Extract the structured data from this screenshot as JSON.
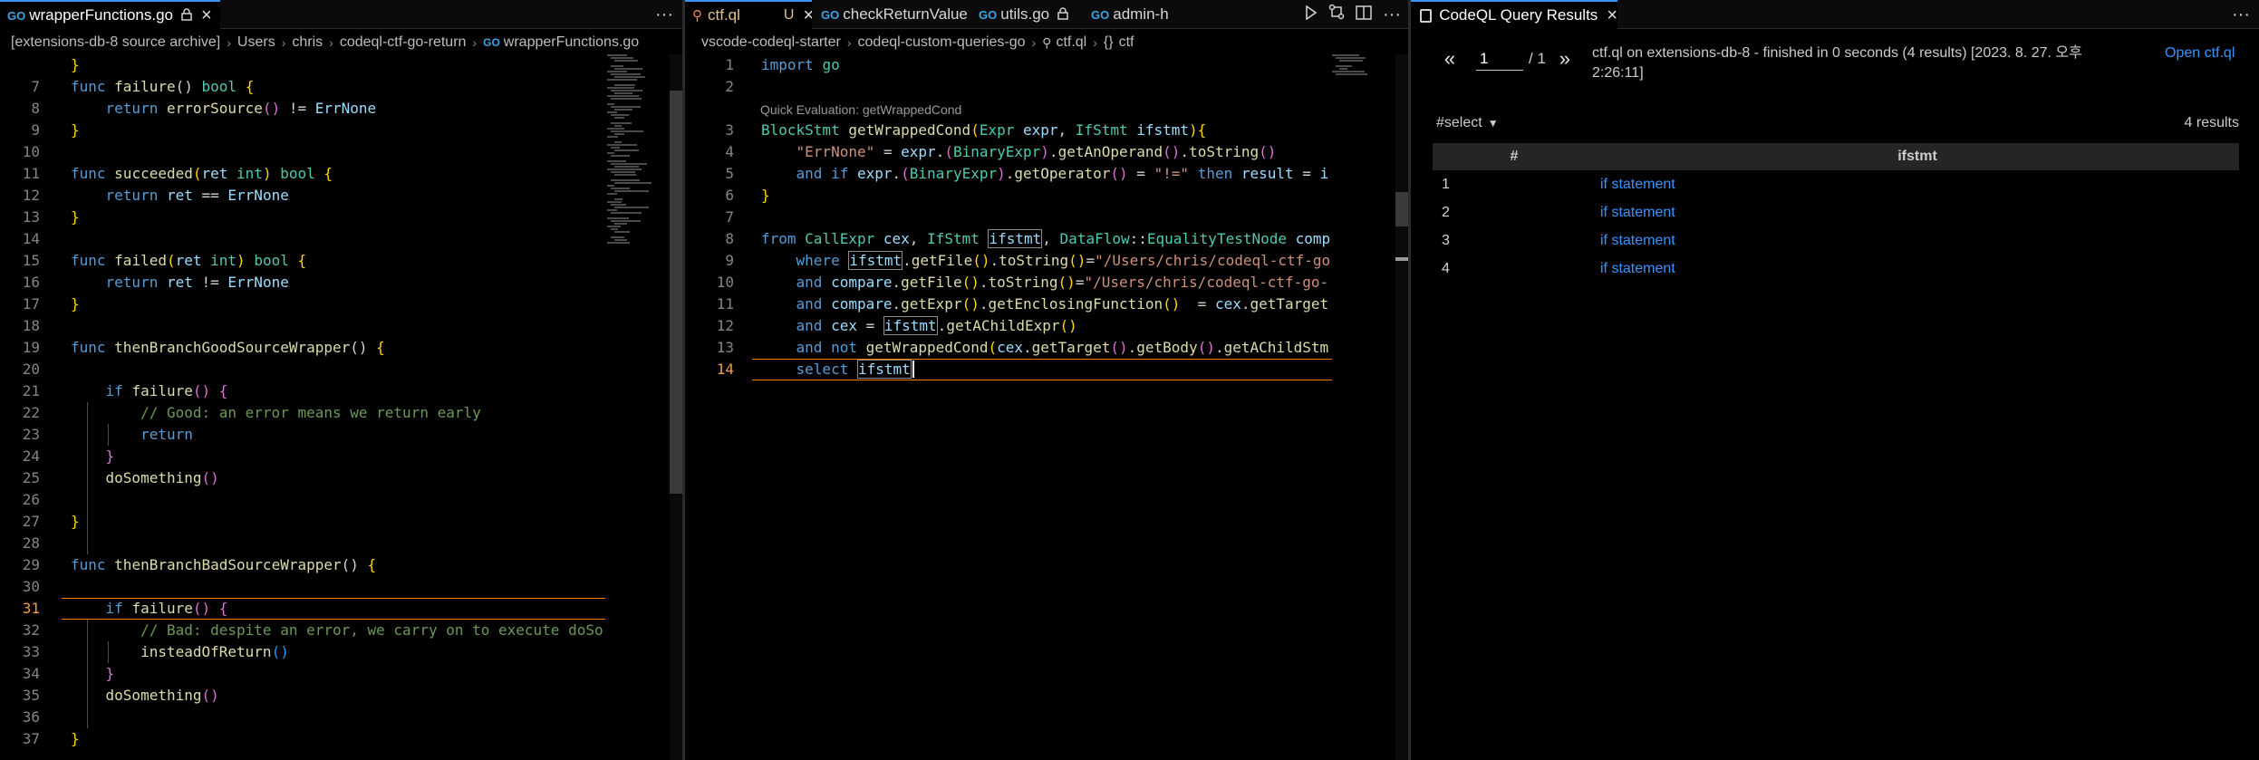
{
  "left_editor": {
    "tab": {
      "label": "wrapperFunctions.go"
    },
    "breadcrumb": [
      "[extensions-db-8 source archive]",
      "Users",
      "chris",
      "codeql-ctf-go-return",
      "wrapperFunctions.go"
    ],
    "current_line": "31",
    "lines": [
      {
        "n": "",
        "code": [
          {
            "t": "}",
            "c": "p1"
          }
        ]
      },
      {
        "n": "7",
        "code": [
          {
            "t": "func ",
            "c": "k"
          },
          {
            "t": "failure",
            "c": "f"
          },
          {
            "t": "() "
          },
          {
            "t": "bool ",
            "c": "t"
          },
          {
            "t": "{",
            "c": "p1"
          }
        ]
      },
      {
        "n": "8",
        "code": [
          {
            "t": "    return ",
            "c": "k"
          },
          {
            "t": "errorSource",
            "c": "f"
          },
          {
            "t": "()",
            "c": "p2"
          },
          {
            "t": " != "
          },
          {
            "t": "ErrNone",
            "c": "v"
          }
        ]
      },
      {
        "n": "9",
        "code": [
          {
            "t": "}",
            "c": "p1"
          }
        ]
      },
      {
        "n": "10",
        "code": []
      },
      {
        "n": "11",
        "code": [
          {
            "t": "func ",
            "c": "k"
          },
          {
            "t": "succeeded",
            "c": "f"
          },
          {
            "t": "(",
            "c": "p1"
          },
          {
            "t": "ret ",
            "c": "v"
          },
          {
            "t": "int",
            "c": "t"
          },
          {
            "t": ") ",
            "c": "p1"
          },
          {
            "t": "bool ",
            "c": "t"
          },
          {
            "t": "{",
            "c": "p1"
          }
        ]
      },
      {
        "n": "12",
        "code": [
          {
            "t": "    return ",
            "c": "k"
          },
          {
            "t": "ret ",
            "c": "v"
          },
          {
            "t": "== "
          },
          {
            "t": "ErrNone",
            "c": "v"
          }
        ]
      },
      {
        "n": "13",
        "code": [
          {
            "t": "}",
            "c": "p1"
          }
        ]
      },
      {
        "n": "14",
        "code": []
      },
      {
        "n": "15",
        "code": [
          {
            "t": "func ",
            "c": "k"
          },
          {
            "t": "failed",
            "c": "f"
          },
          {
            "t": "(",
            "c": "p1"
          },
          {
            "t": "ret ",
            "c": "v"
          },
          {
            "t": "int",
            "c": "t"
          },
          {
            "t": ") ",
            "c": "p1"
          },
          {
            "t": "bool ",
            "c": "t"
          },
          {
            "t": "{",
            "c": "p1"
          }
        ]
      },
      {
        "n": "16",
        "code": [
          {
            "t": "    return ",
            "c": "k"
          },
          {
            "t": "ret ",
            "c": "v"
          },
          {
            "t": "!= "
          },
          {
            "t": "ErrNone",
            "c": "v"
          }
        ]
      },
      {
        "n": "17",
        "code": [
          {
            "t": "}",
            "c": "p1"
          }
        ]
      },
      {
        "n": "18",
        "code": []
      },
      {
        "n": "19",
        "code": [
          {
            "t": "func ",
            "c": "k"
          },
          {
            "t": "thenBranchGoodSourceWrapper",
            "c": "f"
          },
          {
            "t": "() "
          },
          {
            "t": "{",
            "c": "p1"
          }
        ]
      },
      {
        "n": "20",
        "code": []
      },
      {
        "n": "21",
        "code": [
          {
            "t": "    if ",
            "c": "k"
          },
          {
            "t": "failure",
            "c": "f"
          },
          {
            "t": "() ",
            "c": "p2"
          },
          {
            "t": "{",
            "c": "p2"
          }
        ]
      },
      {
        "n": "22",
        "code": [
          {
            "t": "        // Good: an error means we return early",
            "c": "c"
          }
        ]
      },
      {
        "n": "23",
        "code": [
          {
            "t": "        return",
            "c": "k"
          }
        ]
      },
      {
        "n": "24",
        "code": [
          {
            "t": "    }",
            "c": "p2"
          }
        ]
      },
      {
        "n": "25",
        "code": [
          {
            "t": "    doSomething",
            "c": "f"
          },
          {
            "t": "()",
            "c": "p2"
          }
        ]
      },
      {
        "n": "26",
        "code": []
      },
      {
        "n": "27",
        "code": [
          {
            "t": "}",
            "c": "p1"
          }
        ]
      },
      {
        "n": "28",
        "code": []
      },
      {
        "n": "29",
        "code": [
          {
            "t": "func ",
            "c": "k"
          },
          {
            "t": "thenBranchBadSourceWrapper",
            "c": "f"
          },
          {
            "t": "() "
          },
          {
            "t": "{",
            "c": "p1"
          }
        ]
      },
      {
        "n": "30",
        "code": []
      },
      {
        "n": "31",
        "code": [
          {
            "t": "    if ",
            "c": "k"
          },
          {
            "t": "failure",
            "c": "f"
          },
          {
            "t": "() ",
            "c": "p2"
          },
          {
            "t": "{",
            "c": "p2"
          }
        ]
      },
      {
        "n": "32",
        "code": [
          {
            "t": "        // Bad: despite an error, we carry on to execute doSo",
            "c": "c"
          }
        ]
      },
      {
        "n": "33",
        "code": [
          {
            "t": "        insteadOfReturn",
            "c": "f"
          },
          {
            "t": "()",
            "c": "p3"
          }
        ]
      },
      {
        "n": "34",
        "code": [
          {
            "t": "    }",
            "c": "p2"
          }
        ]
      },
      {
        "n": "35",
        "code": [
          {
            "t": "    doSomething",
            "c": "f"
          },
          {
            "t": "()",
            "c": "p2"
          }
        ]
      },
      {
        "n": "36",
        "code": []
      },
      {
        "n": "37",
        "code": [
          {
            "t": "}",
            "c": "p1"
          }
        ]
      }
    ]
  },
  "middle_editor": {
    "tabs": [
      {
        "label": "ctf.ql",
        "status": "U"
      },
      {
        "label": "checkReturnValue.go"
      },
      {
        "label": "utils.go"
      },
      {
        "label": "admin-h"
      }
    ],
    "breadcrumb": [
      "vscode-codeql-starter",
      "codeql-custom-queries-go",
      "ctf.ql",
      "ctf"
    ],
    "breadcrumb_symbol": "{}",
    "codelens": "Quick Evaluation: getWrappedCond",
    "current_line": "14",
    "lines": [
      {
        "n": "1",
        "code": [
          {
            "t": "import ",
            "c": "k"
          },
          {
            "t": "go",
            "c": "t"
          }
        ]
      },
      {
        "n": "2",
        "code": []
      },
      {
        "n": "3",
        "code": [
          {
            "t": "BlockStmt ",
            "c": "t"
          },
          {
            "t": "getWrappedCond",
            "c": "f"
          },
          {
            "t": "(",
            "c": "p1"
          },
          {
            "t": "Expr ",
            "c": "t"
          },
          {
            "t": "expr",
            "c": "v"
          },
          {
            "t": ", "
          },
          {
            "t": "IfStmt ",
            "c": "t"
          },
          {
            "t": "ifstmt",
            "c": "v"
          },
          {
            "t": ")",
            "c": "p1"
          },
          {
            "t": "{",
            "c": "p1"
          }
        ]
      },
      {
        "n": "4",
        "code": [
          {
            "t": "    \"ErrNone\"",
            "c": "s"
          },
          {
            "t": " = "
          },
          {
            "t": "expr",
            "c": "v"
          },
          {
            "t": "."
          },
          {
            "t": "(",
            "c": "p2"
          },
          {
            "t": "BinaryExpr",
            "c": "t"
          },
          {
            "t": ")",
            "c": "p2"
          },
          {
            "t": "."
          },
          {
            "t": "getAnOperand",
            "c": "f"
          },
          {
            "t": "()",
            "c": "p2"
          },
          {
            "t": "."
          },
          {
            "t": "toString",
            "c": "f"
          },
          {
            "t": "()",
            "c": "p2"
          }
        ]
      },
      {
        "n": "5",
        "code": [
          {
            "t": "    and if ",
            "c": "k"
          },
          {
            "t": "expr",
            "c": "v"
          },
          {
            "t": "."
          },
          {
            "t": "(",
            "c": "p2"
          },
          {
            "t": "BinaryExpr",
            "c": "t"
          },
          {
            "t": ")",
            "c": "p2"
          },
          {
            "t": "."
          },
          {
            "t": "getOperator",
            "c": "f"
          },
          {
            "t": "()",
            "c": "p2"
          },
          {
            "t": " = "
          },
          {
            "t": "\"!=\"",
            "c": "s"
          },
          {
            "t": " then ",
            "c": "k"
          },
          {
            "t": "result",
            "c": "v"
          },
          {
            "t": " = "
          },
          {
            "t": "i",
            "c": "v"
          }
        ]
      },
      {
        "n": "6",
        "code": [
          {
            "t": "}",
            "c": "p1"
          }
        ]
      },
      {
        "n": "7",
        "code": []
      },
      {
        "n": "8",
        "code": [
          {
            "t": "from ",
            "c": "k"
          },
          {
            "t": "CallExpr ",
            "c": "t"
          },
          {
            "t": "cex",
            "c": "v"
          },
          {
            "t": ", "
          },
          {
            "t": "IfStmt ",
            "c": "t"
          },
          {
            "t": "ifstmt",
            "c": "v",
            "h": true
          },
          {
            "t": ", "
          },
          {
            "t": "DataFlow",
            "c": "t"
          },
          {
            "t": "::"
          },
          {
            "t": "EqualityTestNode ",
            "c": "t"
          },
          {
            "t": "comp",
            "c": "v"
          }
        ]
      },
      {
        "n": "9",
        "code": [
          {
            "t": "    where ",
            "c": "k"
          },
          {
            "t": "ifstmt",
            "c": "v",
            "h": true
          },
          {
            "t": "."
          },
          {
            "t": "getFile",
            "c": "f"
          },
          {
            "t": "()",
            "c": "p1"
          },
          {
            "t": "."
          },
          {
            "t": "toString",
            "c": "f"
          },
          {
            "t": "()",
            "c": "p1"
          },
          {
            "t": "="
          },
          {
            "t": "\"/Users/chris/codeql-ctf-go",
            "c": "s"
          }
        ]
      },
      {
        "n": "10",
        "code": [
          {
            "t": "    and ",
            "c": "k"
          },
          {
            "t": "compare",
            "c": "v"
          },
          {
            "t": "."
          },
          {
            "t": "getFile",
            "c": "f"
          },
          {
            "t": "()",
            "c": "p1"
          },
          {
            "t": "."
          },
          {
            "t": "toString",
            "c": "f"
          },
          {
            "t": "()",
            "c": "p1"
          },
          {
            "t": "="
          },
          {
            "t": "\"/Users/chris/codeql-ctf-go-",
            "c": "s"
          }
        ]
      },
      {
        "n": "11",
        "code": [
          {
            "t": "    and ",
            "c": "k"
          },
          {
            "t": "compare",
            "c": "v"
          },
          {
            "t": "."
          },
          {
            "t": "getExpr",
            "c": "f"
          },
          {
            "t": "()",
            "c": "p1"
          },
          {
            "t": "."
          },
          {
            "t": "getEnclosingFunction",
            "c": "f"
          },
          {
            "t": "()",
            "c": "p1"
          },
          {
            "t": "  = "
          },
          {
            "t": "cex",
            "c": "v"
          },
          {
            "t": "."
          },
          {
            "t": "getTarget",
            "c": "f"
          }
        ]
      },
      {
        "n": "12",
        "code": [
          {
            "t": "    and ",
            "c": "k"
          },
          {
            "t": "cex",
            "c": "v"
          },
          {
            "t": " = "
          },
          {
            "t": "ifstmt",
            "c": "v",
            "h": true
          },
          {
            "t": "."
          },
          {
            "t": "getAChildExpr",
            "c": "f"
          },
          {
            "t": "()",
            "c": "p1"
          }
        ]
      },
      {
        "n": "13",
        "code": [
          {
            "t": "    and not ",
            "c": "k"
          },
          {
            "t": "getWrappedCond",
            "c": "f"
          },
          {
            "t": "(",
            "c": "p1"
          },
          {
            "t": "cex",
            "c": "v"
          },
          {
            "t": "."
          },
          {
            "t": "getTarget",
            "c": "f"
          },
          {
            "t": "()",
            "c": "p2"
          },
          {
            "t": "."
          },
          {
            "t": "getBody",
            "c": "f"
          },
          {
            "t": "()",
            "c": "p2"
          },
          {
            "t": "."
          },
          {
            "t": "getAChildStm",
            "c": "f"
          }
        ]
      },
      {
        "n": "14",
        "code": [
          {
            "t": "    select ",
            "c": "k"
          },
          {
            "t": "ifstmt",
            "c": "v",
            "h": true
          }
        ]
      }
    ]
  },
  "results_panel": {
    "tab": {
      "label": "CodeQL Query Results"
    },
    "pager": {
      "prev": "«",
      "page": "1",
      "total": "/ 1",
      "next": "»"
    },
    "info": "ctf.ql on extensions-db-8 - finished in 0 seconds (4 results) [2023. 8. 27. 오후 2:26:11]",
    "open_link": "Open ctf.ql",
    "result_set": "#select",
    "count": "4 results",
    "columns": [
      "#",
      "ifstmt"
    ],
    "rows": [
      {
        "index": "1",
        "value": "if statement"
      },
      {
        "index": "2",
        "value": "if statement"
      },
      {
        "index": "3",
        "value": "if statement"
      },
      {
        "index": "4",
        "value": "if statement"
      }
    ]
  },
  "icons": {
    "go_file": "go-file-icon",
    "ql_file": "ql-file-icon",
    "lock": "lock-icon",
    "close": "close-icon",
    "more": "more-actions-icon",
    "run": "run-icon",
    "compare": "compare-icon",
    "split": "split-editor-icon",
    "results": "results-icon"
  },
  "colors": {
    "accent": "#3794ff",
    "modified": "#e2c08d",
    "current_line_border": "#ff7a00",
    "current_line_number": "#f49b45"
  }
}
